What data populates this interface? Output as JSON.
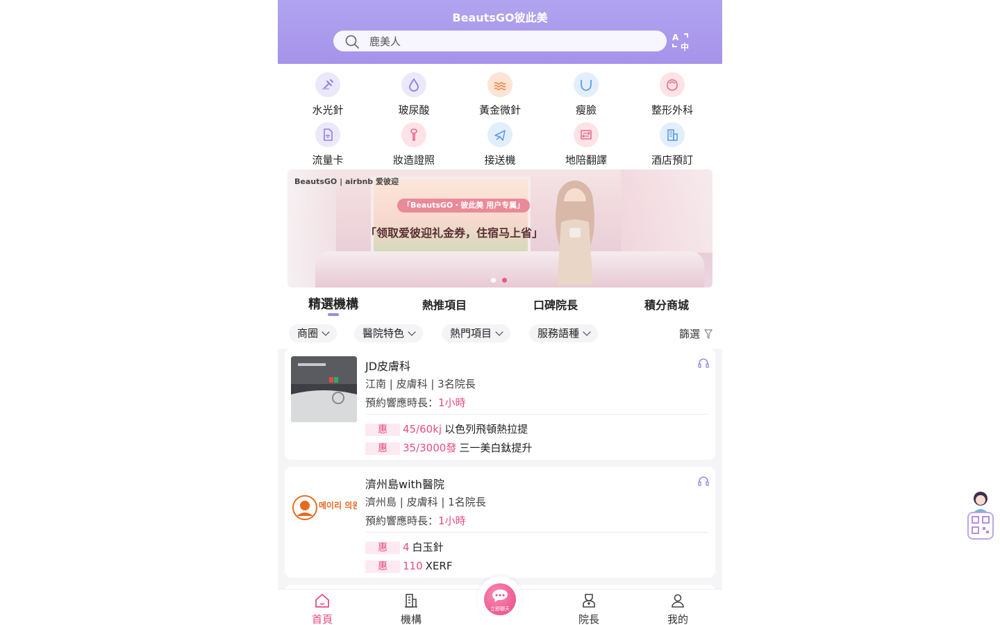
{
  "header": {
    "title": "BeautsGO彼此美"
  },
  "search": {
    "placeholder": "鹿美人",
    "icon": "search-icon"
  },
  "translate": {
    "icon": "translate-icon"
  },
  "categories": [
    {
      "label": "水光針",
      "icon": "syringe-icon",
      "color": "#ece8fb"
    },
    {
      "label": "玻尿酸",
      "icon": "droplet-icon",
      "color": "#ece8fb"
    },
    {
      "label": "黃金微針",
      "icon": "gold-wave-icon",
      "color": "#fde4d6"
    },
    {
      "label": "瘦臉",
      "icon": "face-contour-icon",
      "color": "#e2eefb"
    },
    {
      "label": "整形外科",
      "icon": "face-icon",
      "color": "#fde2e6"
    },
    {
      "label": "流量卡",
      "icon": "sim-card-icon",
      "color": "#ece8fb"
    },
    {
      "label": "妝造證照",
      "icon": "makeup-brush-icon",
      "color": "#fde2e6"
    },
    {
      "label": "接送機",
      "icon": "airplane-icon",
      "color": "#e2eefb"
    },
    {
      "label": "地陪翻譯",
      "icon": "translate-book-icon",
      "color": "#fde2e6"
    },
    {
      "label": "酒店預訂",
      "icon": "hotel-icon",
      "color": "#e2eefb"
    }
  ],
  "banner": {
    "brand": "BeautsGO | airbnb 爱彼迎",
    "tag": "「BeautsGO・彼此美 用户专属」",
    "headline": "「领取爱彼迎礼金券，住宿马上省」",
    "slides": 2,
    "active_slide": 2
  },
  "tabs": [
    {
      "label": "精選機構",
      "active": true
    },
    {
      "label": "熱推項目",
      "active": false
    },
    {
      "label": "口碑院長",
      "active": false
    },
    {
      "label": "積分商城",
      "active": false
    }
  ],
  "filters": {
    "chips": [
      "商圈",
      "醫院特色",
      "熱門項目",
      "服務語種"
    ],
    "filter_label": "篩選"
  },
  "clinics": [
    {
      "name": "JD皮膚科",
      "meta": "江南 |  皮膚科 |  3名院長",
      "response_label": "預約響應時長：",
      "response_value": "1小時",
      "promos": [
        {
          "tag": "惠",
          "price": "45/60kj",
          "name": "以色列飛頓熱拉提"
        },
        {
          "tag": "惠",
          "price": "35/3000發",
          "name": "三一美白鈦提升"
        }
      ]
    },
    {
      "name": "濟州島with醫院",
      "meta": "濟州島 |  皮膚科 |  1名院長",
      "response_label": "預約響應時長：",
      "response_value": "1小時",
      "logo_text": "메이리 의원",
      "promos": [
        {
          "tag": "惠",
          "price": "4",
          "name": "白玉針"
        },
        {
          "tag": "惠",
          "price": "110",
          "name": "XERF"
        }
      ]
    }
  ],
  "bottom_nav": {
    "items": [
      {
        "label": "首頁",
        "icon": "home-icon",
        "active": true
      },
      {
        "label": "機構",
        "icon": "building-icon",
        "active": false
      },
      {
        "label": "院長",
        "icon": "doctor-icon",
        "active": false
      },
      {
        "label": "我的",
        "icon": "user-icon",
        "active": false
      }
    ],
    "chat_label": "立即聊天"
  },
  "colors": {
    "accent": "#e84a80",
    "header": "#a593ea",
    "tab_indicator": "#9b8ae3"
  }
}
